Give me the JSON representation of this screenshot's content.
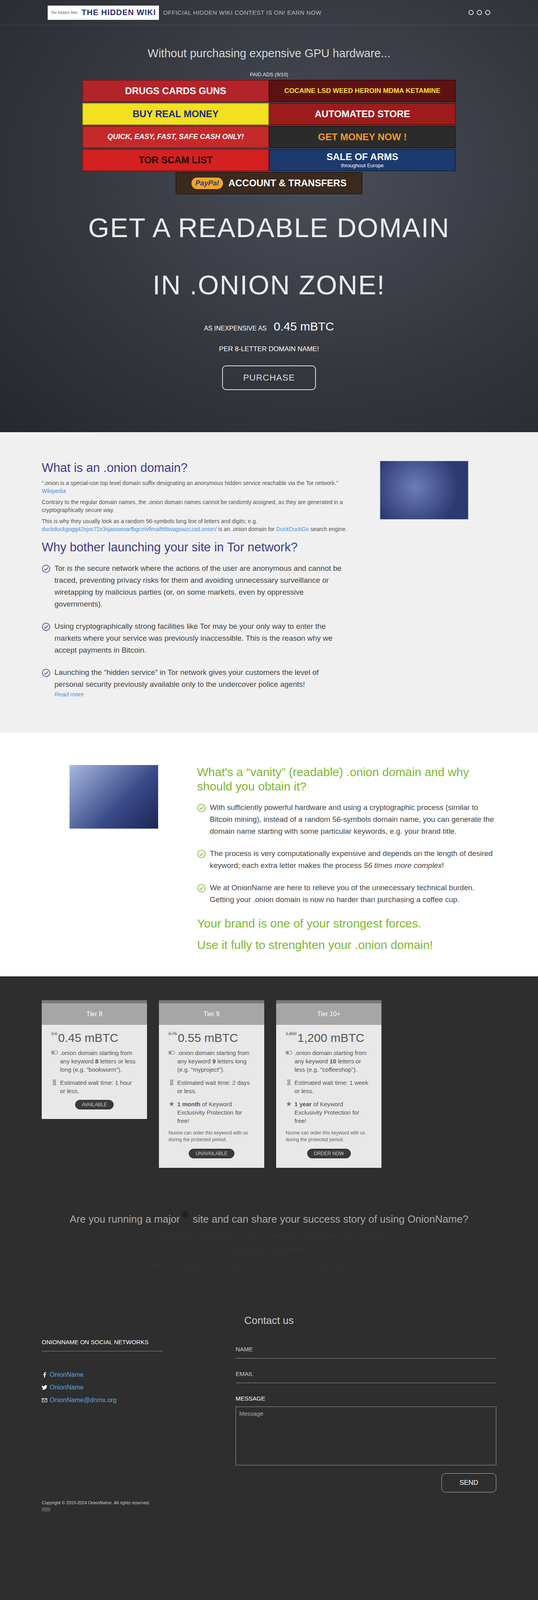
{
  "header": {
    "logo_small": "The Hidden Wiki",
    "logo_title": "THE HIDDEN WIKI",
    "notice": "OFFICIAL HIDDEN WIKI CONTEST IS ON! EARN NOW"
  },
  "hero": {
    "intro": "Without purchasing expensive GPU hardware...",
    "ads_label": "PAID ADS (9/10)",
    "ads": [
      {
        "text": "DRUGS CARDS GUNS",
        "sub": "",
        "color": "#b3242a",
        "text_color": "#ffffff"
      },
      {
        "text": "COCAINE LSD WEED HEROIN MDMA KETAMINE",
        "sub": "",
        "color": "#5c1212",
        "text_color": "#ffe23a"
      },
      {
        "text": "BUY REAL MONEY",
        "sub": "",
        "color": "#f3e01e",
        "text_color": "#1a2a7a"
      },
      {
        "text": "AUTOMATED STORE",
        "sub": "",
        "color": "#9c1c1c",
        "text_color": "#ffffff"
      },
      {
        "text": "QUICK, EASY, FAST, SAFE CASH ONLY!",
        "sub": "",
        "color": "#c42a2a",
        "text_color": "#ffffff"
      },
      {
        "text": "GET MONEY NOW !",
        "sub": "",
        "color": "#2b2b2b",
        "text_color": "#ff9a1a"
      },
      {
        "text": "TOR SCAM LIST",
        "sub": "",
        "color": "#d42020",
        "text_color": "#1a0000"
      },
      {
        "text": "SALE OF ARMS",
        "sub": "throughout Europe",
        "color": "#1d3a6e",
        "text_color": "#ffffff"
      },
      {
        "text": "ACCOUNT & TRANSFERS",
        "sub": "PayPal",
        "color": "#3a2a1e",
        "text_color": "#ffffff"
      }
    ],
    "title_1": "GET A READABLE DOMAIN",
    "title_2": "IN .ONION ZONE!",
    "price_prefix": "AS INEXPENSIVE AS",
    "price": "0.45 mBTC",
    "price_suffix": "PER 8-LETTER DOMAIN NAME!",
    "button": "PURCHASE"
  },
  "about": {
    "title": "What is an .onion domain?",
    "paragraphs": [
      [
        {
          "kind": "text",
          "text": "“.onion is a special-use top level domain suffix designating an anonymous hidden service reachable via the Tor network.” "
        },
        {
          "kind": "link",
          "text": "Wikipedia"
        }
      ],
      [
        {
          "kind": "text",
          "text": "Contrary to the regular domain names, the "
        },
        {
          "kind": "em",
          "text": ".onion"
        },
        {
          "kind": "text",
          "text": " domain names cannot be randomly assigned, as they are generated in a cryptographically secure way."
        }
      ],
      [
        {
          "kind": "text",
          "text": "This is why they usually look as a random 56-symbols long line of letters and digits; e.g. "
        },
        {
          "kind": "link",
          "text": "duckduckgogg42xjoc72x3sjasowoarfbgcmvfimaftt6twagswzczad.onion/"
        },
        {
          "kind": "text",
          "text": " is an .onion domain for "
        },
        {
          "kind": "link",
          "text": "DuckDuckGo"
        },
        {
          "kind": "text",
          "text": " search engine."
        }
      ]
    ],
    "why_title": "Why bother launching your site in Tor network?",
    "why_items": [
      [
        {
          "kind": "text",
          "text": "Tor is the secure network where the actions of the user are anonymous and cannot be traced, preventing privacy risks for them and avoiding unnecessary surveillance or wiretapping by malicious parties (or, on some markets, even by oppressive governments)."
        }
      ],
      [
        {
          "kind": "text",
          "text": "Using cryptographically strong facilities like Tor may be your only way to enter the markets where your service was previously inaccessible. This is the reason why we accept payments in Bitcoin."
        }
      ],
      [
        {
          "kind": "text",
          "text": "Launching the “hidden service” in Tor network gives your customers the level of personal security previously available only to the undercover police agents!"
        },
        {
          "kind": "block-link",
          "text": "Read more"
        }
      ]
    ]
  },
  "vanity": {
    "title": "What's a “vanity” (readable) .onion domain and why should you obtain it?",
    "items": [
      [
        {
          "kind": "text",
          "text": "With sufficiently powerful hardware and using a cryptographic process (similar to Bitcoin mining), instead of a random 56-symbols domain name, you can generate the domain name starting with some particular keywords, e.g. your brand title."
        }
      ],
      [
        {
          "kind": "text",
          "text": "The process is very computationally expensive and depends on the length of desired keyword; each extra letter makes the process "
        },
        {
          "kind": "em",
          "text": "56 times more complex"
        },
        {
          "kind": "text",
          "text": "!"
        }
      ],
      [
        {
          "kind": "text",
          "text": "We at OnionName are here to relieve you of the unnecessary technical burden. Getting your .onion domain is now no harder than purchasing a coffee cup."
        }
      ]
    ],
    "slogan_1": "Your brand is one of your strongest forces.",
    "slogan_2": "Use it fully to strenghten your .onion domain!"
  },
  "tiers": [
    {
      "name": "Tier 8",
      "old_price": "0.6",
      "price": "0.45 mBTC",
      "features": [
        {
          "kind": "size",
          "segments": [
            {
              "kind": "text",
              "text": ".onion domain starting from any keyword "
            },
            {
              "kind": "strong",
              "text": "8"
            },
            {
              "kind": "text",
              "text": " letters or less long (e.g. \"bookworm\")."
            }
          ]
        },
        {
          "kind": "time",
          "segments": [
            {
              "kind": "text",
              "text": "Estimated wait time: 1 hour or less."
            }
          ]
        }
      ],
      "note": "",
      "button": "AVAILABLE"
    },
    {
      "name": "Tier 9",
      "old_price": "0.75",
      "price": "0.55 mBTC",
      "features": [
        {
          "kind": "size",
          "segments": [
            {
              "kind": "text",
              "text": ".onion domain starting from any keyword "
            },
            {
              "kind": "strong",
              "text": "9"
            },
            {
              "kind": "text",
              "text": " letters long (e.g. \"myproject\")."
            }
          ]
        },
        {
          "kind": "time",
          "segments": [
            {
              "kind": "text",
              "text": "Estimated wait time: 2 days or less."
            }
          ]
        },
        {
          "kind": "protection",
          "segments": [
            {
              "kind": "strong",
              "text": "1 month"
            },
            {
              "kind": "text",
              "text": " of Keyword Exclusivity Protection for free!"
            }
          ]
        }
      ],
      "note": "Noone can order this keyword with us during the protected period.",
      "button": "UNAVAILABLE"
    },
    {
      "name": "Tier 10+",
      "old_price": "1,800",
      "price": "1,200 mBTC",
      "features": [
        {
          "kind": "size",
          "segments": [
            {
              "kind": "text",
              "text": ".onion domain starting from any keyword "
            },
            {
              "kind": "strong",
              "text": "10"
            },
            {
              "kind": "text",
              "text": " letters or less (e.g. \"coffeeshop\")."
            }
          ]
        },
        {
          "kind": "time",
          "segments": [
            {
              "kind": "text",
              "text": "Estimated wait time: 1 week or less."
            }
          ]
        },
        {
          "kind": "protection",
          "segments": [
            {
              "kind": "strong",
              "text": "1 year"
            },
            {
              "kind": "text",
              "text": " of Keyword Exclusivity Protection for free!"
            }
          ]
        }
      ],
      "note": "Noone can order this keyword with us during the protected period.",
      "button": "ORDER NOW"
    }
  ],
  "success": {
    "question_pre": "Are you running a major",
    "question_mark": "✹",
    "question_post": " site and can share your success story of using OnionName?",
    "eligible_pre": "You may be eligible for 1 year or more of free ",
    "eligible_em": "Private Tier",
    "eligible_post": " service!",
    "contact": "Contact us for details.",
    "footnote_mark": "✹",
    "footnote": " Consider global Alexa rank 100 000 or less, or country-wide Alexa rank 10 000 or less."
  },
  "footer": {
    "title": "Contact us",
    "social_title": "ONIONNAME ON SOCIAL NETWORKS",
    "links": [
      {
        "kind": "facebook",
        "label": "OnionName"
      },
      {
        "kind": "twitter",
        "label": "OnionName"
      },
      {
        "kind": "email",
        "label": "OnionName@dnmx.org"
      }
    ],
    "form": {
      "name": "NAME",
      "email": "EMAIL",
      "message_label": "MESSAGE",
      "message_placeholder": "Message",
      "send": "SEND"
    },
    "copyright": "Copyright © 2015-2024 OnionName. All rights reserved."
  }
}
